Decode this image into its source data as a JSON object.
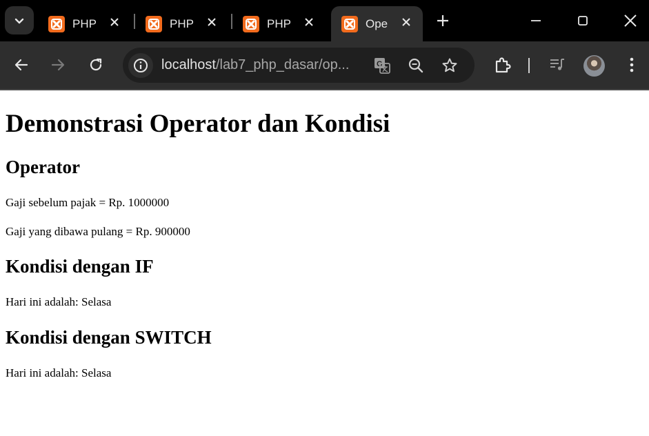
{
  "browser": {
    "tabs": [
      {
        "title": "PHP",
        "active": false
      },
      {
        "title": "PHP",
        "active": false
      },
      {
        "title": "PHP",
        "active": false
      },
      {
        "title": "Ope",
        "active": true
      }
    ],
    "address": {
      "host": "localhost",
      "path": "/lab7_php_dasar/op..."
    },
    "colors": {
      "tabstrip": "#000000",
      "toolbar": "#2e2e2e",
      "favicon": "#f26b1d"
    }
  },
  "page": {
    "title": "Demonstrasi Operator dan Kondisi",
    "sections": [
      {
        "heading": "Operator",
        "lines": [
          "Gaji sebelum pajak = Rp. 1000000",
          "Gaji yang dibawa pulang = Rp. 900000"
        ]
      },
      {
        "heading": "Kondisi dengan IF",
        "lines": [
          "Hari ini adalah: Selasa"
        ]
      },
      {
        "heading": "Kondisi dengan SWITCH",
        "lines": [
          "Hari ini adalah: Selasa"
        ]
      }
    ]
  }
}
